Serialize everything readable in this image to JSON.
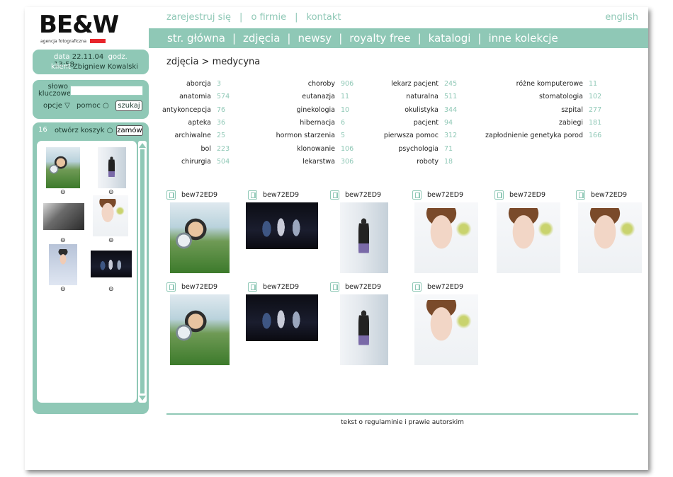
{
  "logo": {
    "text": "BE&W",
    "subtitle": "agencja fotograficzna",
    "accent": "#e8262c"
  },
  "topnav": {
    "register": "zarejestruj się",
    "about": "o firmie",
    "contact": "kontakt",
    "sep": "|",
    "language": "english"
  },
  "mainnav": {
    "items": [
      "str. główna",
      "zdjęcia",
      "newsy",
      "royalty free",
      "katalogi",
      "inne kolekcje"
    ],
    "sep": "|"
  },
  "session": {
    "date_label": "data",
    "date": "22.11.04",
    "time_label": "godz.",
    "time": "13:58",
    "client_label": "klient",
    "client": "Zbigniew Kowalski"
  },
  "search": {
    "keywords_label_1": "słowo",
    "keywords_label_2": "kluczowe",
    "keywords_value": "",
    "options": "opcje ▽",
    "help": "pomoc ○",
    "submit": "szukaj"
  },
  "cart": {
    "count": "16",
    "open": "otwórz koszyk ○",
    "order": "zamów",
    "remove": "⊖"
  },
  "breadcrumb": "zdjęcia > medycyna",
  "categories": [
    [
      {
        "name": "aborcja",
        "count": "3"
      },
      {
        "name": "anatomia",
        "count": "574"
      },
      {
        "name": "antykoncepcja",
        "count": "76"
      },
      {
        "name": "apteka",
        "count": "36"
      },
      {
        "name": "archiwalne",
        "count": "25"
      },
      {
        "name": "bol",
        "count": "223"
      },
      {
        "name": "chirurgia",
        "count": "504"
      }
    ],
    [
      {
        "name": "choroby",
        "count": "906"
      },
      {
        "name": "eutanazja",
        "count": "11"
      },
      {
        "name": "ginekologia",
        "count": "10"
      },
      {
        "name": "hibernacja",
        "count": "6"
      },
      {
        "name": "hormon starzenia",
        "count": "5"
      },
      {
        "name": "klonowanie",
        "count": "106"
      },
      {
        "name": "lekarstwa",
        "count": "306"
      }
    ],
    [
      {
        "name": "lekarz pacjent",
        "count": "245"
      },
      {
        "name": "naturalna",
        "count": "511"
      },
      {
        "name": "okulistyka",
        "count": "344"
      },
      {
        "name": "pacjent",
        "count": "94"
      },
      {
        "name": "pierwsza pomoc",
        "count": "312"
      },
      {
        "name": "psychologia",
        "count": "71"
      },
      {
        "name": "roboty",
        "count": "18"
      }
    ],
    [
      {
        "name": "różne komputerowe",
        "count": "11"
      },
      {
        "name": "stomatologia",
        "count": "102"
      },
      {
        "name": "szpital",
        "count": "277"
      },
      {
        "name": "zabiegi",
        "count": "181"
      },
      {
        "name": "zapłodnienie genetyka porod",
        "count": "166"
      }
    ]
  ],
  "tiles": [
    {
      "code": "bew72ED9",
      "kind": "car"
    },
    {
      "code": "bew72ED9",
      "kind": "dance"
    },
    {
      "code": "bew72ED9",
      "kind": "walk"
    },
    {
      "code": "bew72ED9",
      "kind": "girl"
    },
    {
      "code": "bew72ED9",
      "kind": "girl"
    },
    {
      "code": "bew72ED9",
      "kind": "girl"
    },
    {
      "code": "bew72ED9",
      "kind": "car"
    },
    {
      "code": "bew72ED9",
      "kind": "dance"
    },
    {
      "code": "bew72ED9",
      "kind": "walk"
    },
    {
      "code": "bew72ED9",
      "kind": "girl"
    }
  ],
  "cart_items": [
    "car",
    "walk",
    "shadow",
    "girl",
    "bed",
    "dance"
  ],
  "footer": "tekst o regulaminie i prawie autorskim",
  "colors": {
    "accent": "#8fc8b6",
    "dark_text": "#1d3b30"
  }
}
